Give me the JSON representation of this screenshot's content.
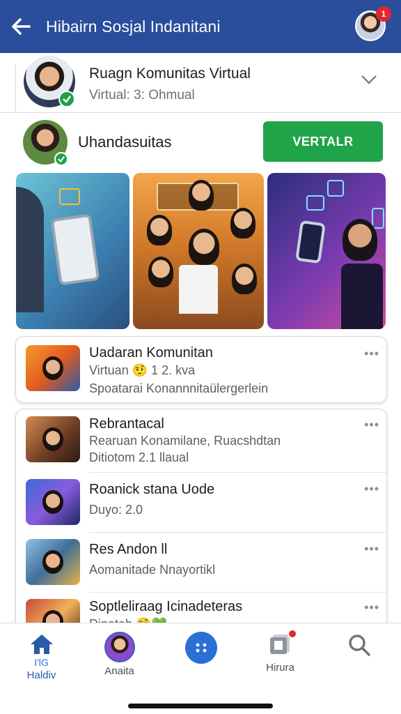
{
  "header": {
    "title": "Hibairn Sosjal Indanitani",
    "back_icon": "arrow-left-icon",
    "notification_count": "1"
  },
  "room": {
    "title": "Ruagn Komunitas Virtual",
    "subtitle": "Virtual: 3: Ohmual",
    "expand_icon": "chevron-down-icon"
  },
  "host": {
    "name": "Uhandasuitas",
    "follow_label": "VERTALR"
  },
  "gallery": [
    {
      "name": "gallery-tile-phone-hand"
    },
    {
      "name": "gallery-tile-group-photo"
    },
    {
      "name": "gallery-tile-tech-music"
    }
  ],
  "featured": {
    "title": "Uadaran Komunitan",
    "line2": "Virtuan 🤨 1 2. kva",
    "line3": "Spoatarai Konannnitaülergerlein",
    "more": "•••"
  },
  "list": [
    {
      "title": "Rebrantacal",
      "line2": "Rearuan Konamilane, Ruacshdtan",
      "line3": "Ditiotom 2.1 llaual",
      "more": "•••"
    },
    {
      "title": "Roanick stana Uode",
      "line2": "Duyo:     2.0",
      "line3": "",
      "more": "•••"
    },
    {
      "title": "Res Andon ll",
      "line2": "Aomanitade Nnayortikl",
      "line3": "",
      "more": "•••"
    },
    {
      "title": "Soptleliraag Icinadeteras",
      "line2": "Dinatab 🤨💚",
      "line3": "",
      "more": "•••"
    }
  ],
  "bottom_nav": {
    "home_sub": "I'lG",
    "home_label": "Haldiv",
    "profile_label": "Anaita",
    "center_label": "",
    "bag_label": "Hirura",
    "search_label": ""
  },
  "colors": {
    "header": "#2a4d9c",
    "follow": "#1fa449",
    "badge": "#e5262b",
    "accent": "#2a6fd6"
  }
}
